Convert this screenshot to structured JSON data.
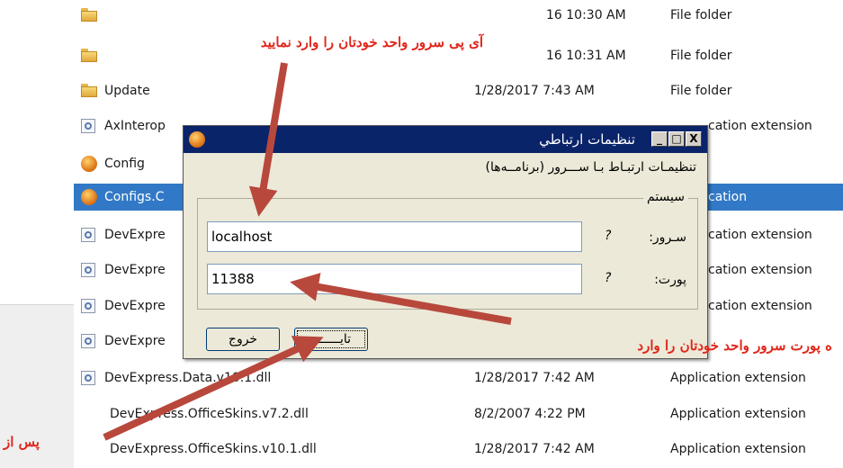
{
  "file_list": [
    {
      "icon": "folder-icon",
      "name": "",
      "date": "16 10:30 AM",
      "type": "File folder"
    },
    {
      "icon": "folder-icon",
      "name": "",
      "date": "16 10:31 AM",
      "type": "File folder"
    },
    {
      "icon": "folder-icon",
      "name": "Update",
      "date": "1/28/2017 7:43 AM",
      "type": "File folder"
    },
    {
      "icon": "dll-icon",
      "name": "AxInterop",
      "date": "",
      "type": "cation extension"
    },
    {
      "icon": "app-icon",
      "name": "Config",
      "date": "",
      "type": ""
    },
    {
      "icon": "app-icon",
      "name": "Configs.C",
      "date": "",
      "type": "cation"
    },
    {
      "icon": "dll-icon",
      "name": "DevExpre",
      "date": "",
      "type": "cation extension"
    },
    {
      "icon": "dll-icon",
      "name": "DevExpre",
      "date": "",
      "type": "cation extension"
    },
    {
      "icon": "dll-icon",
      "name": "DevExpre",
      "date": "",
      "type": "cation extension"
    },
    {
      "icon": "dll-icon",
      "name": "DevExpre",
      "date": "",
      "type": ""
    },
    {
      "icon": "dll-icon",
      "name": "DevExpress.Data.v10.1.dll",
      "date": "1/28/2017 7:42 AM",
      "type": "Application extension"
    },
    {
      "icon": "",
      "name": "DevExpress.OfficeSkins.v7.2.dll",
      "date": "8/2/2007 4:22 PM",
      "type": "Application extension"
    },
    {
      "icon": "",
      "name": "DevExpress.OfficeSkins.v10.1.dll",
      "date": "1/28/2017 7:42 AM",
      "type": "Application extension"
    }
  ],
  "dialog": {
    "title": "تنظيمات ارتباطي",
    "buttons": {
      "close": "X",
      "maximize": "□",
      "minimize": "_"
    },
    "subtitle": "تنظیمـات ارتبـاط بـا ســـرور (برنامــه‌ها)",
    "group_label": "سیستم",
    "server": {
      "label": "سـرور:",
      "value": "localhost",
      "help": "?"
    },
    "port": {
      "label": "پورت:",
      "value": "11388",
      "help": "?"
    },
    "ok_label": "تایــــــد",
    "exit_label": "خروج"
  },
  "annotations": {
    "server_hint": "آی پی سرور واحد خودتان را وارد نمایید",
    "port_hint": "ه پورت سرور واحد خودتان را وارد",
    "confirm_hint": "پس از"
  },
  "colors": {
    "selection": "#3179c6",
    "dialog_title": "#0a246a",
    "annotation": "#e0261b",
    "arrow": "#b8483c"
  }
}
